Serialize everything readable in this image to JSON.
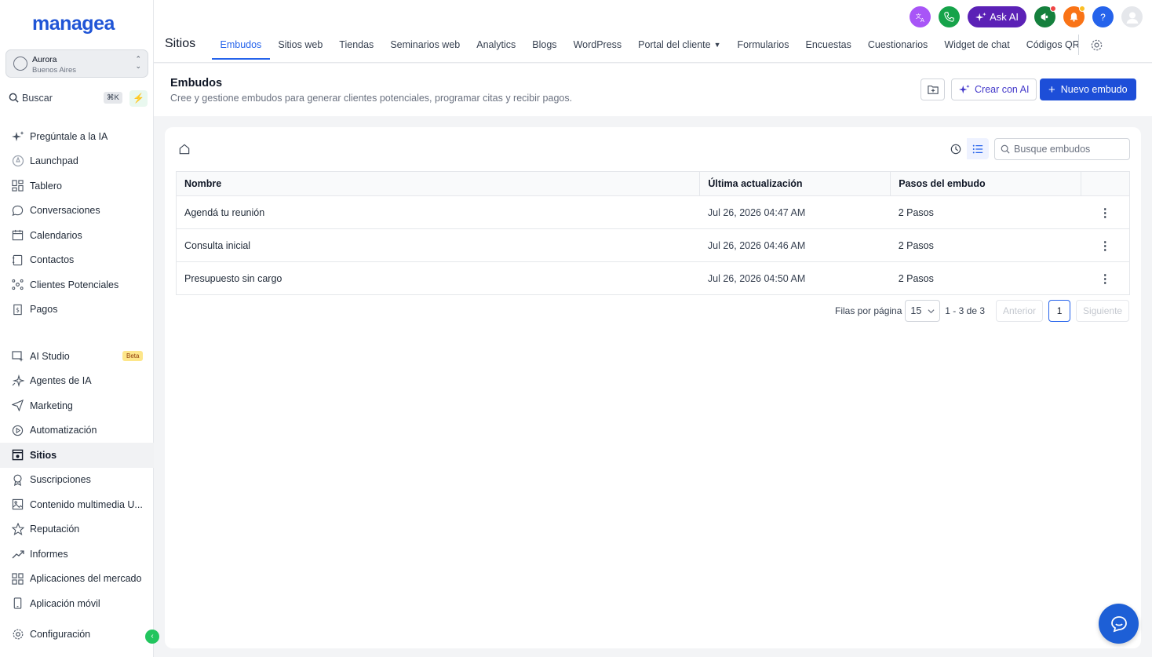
{
  "app": {
    "logo": "managea"
  },
  "account": {
    "name": "Aurora",
    "location": "Buenos Aires"
  },
  "search": {
    "label": "Buscar",
    "shortcut": "⌘K"
  },
  "sidebar": {
    "items": [
      {
        "label": "Pregúntale a la IA",
        "icon": "sparkles-icon"
      },
      {
        "label": "Launchpad",
        "icon": "rocket-icon"
      },
      {
        "label": "Tablero",
        "icon": "dashboard-icon"
      },
      {
        "label": "Conversaciones",
        "icon": "chat-bubble-icon"
      },
      {
        "label": "Calendarios",
        "icon": "calendar-icon"
      },
      {
        "label": "Contactos",
        "icon": "contacts-icon"
      },
      {
        "label": "Clientes Potenciales",
        "icon": "network-icon"
      },
      {
        "label": "Pagos",
        "icon": "invoice-icon"
      }
    ],
    "items2": [
      {
        "label": "AI Studio",
        "icon": "ai-studio-icon",
        "badge": "Beta"
      },
      {
        "label": "Agentes de IA",
        "icon": "ai-agent-icon"
      },
      {
        "label": "Marketing",
        "icon": "send-icon"
      },
      {
        "label": "Automatización",
        "icon": "automation-icon"
      },
      {
        "label": "Sitios",
        "icon": "sites-icon",
        "active": true
      },
      {
        "label": "Suscripciones",
        "icon": "badge-icon"
      },
      {
        "label": "Contenido multimedia U...",
        "icon": "image-icon"
      },
      {
        "label": "Reputación",
        "icon": "star-icon"
      },
      {
        "label": "Informes",
        "icon": "trend-icon"
      },
      {
        "label": "Aplicaciones del mercado",
        "icon": "apps-grid-icon"
      },
      {
        "label": "Aplicación móvil",
        "icon": "mobile-icon"
      }
    ],
    "settings": {
      "label": "Configuración",
      "icon": "gear-icon"
    }
  },
  "header": {
    "section": "Sitios",
    "ask_ai": "Ask AI",
    "tabs": [
      {
        "label": "Embudos",
        "active": true
      },
      {
        "label": "Sitios web"
      },
      {
        "label": "Tiendas"
      },
      {
        "label": "Seminarios web"
      },
      {
        "label": "Analytics"
      },
      {
        "label": "Blogs"
      },
      {
        "label": "WordPress"
      },
      {
        "label": "Portal del cliente",
        "dropdown": true
      },
      {
        "label": "Formularios"
      },
      {
        "label": "Encuestas"
      },
      {
        "label": "Cuestionarios"
      },
      {
        "label": "Widget de chat"
      },
      {
        "label": "Códigos QR"
      }
    ]
  },
  "page": {
    "title": "Embudos",
    "subtitle": "Cree y gestione embudos para generar clientes potenciales, programar citas y recibir pagos.",
    "create_ai_label": "Crear con AI",
    "new_label": "Nuevo embudo"
  },
  "funnels": {
    "search_placeholder": "Busque embudos",
    "columns": [
      "Nombre",
      "Última actualización",
      "Pasos del embudo",
      ""
    ],
    "rows": [
      {
        "name": "Agendá tu reunión",
        "updated": "Jul 26, 2026 04:47 AM",
        "steps": "2 Pasos"
      },
      {
        "name": "Consulta inicial",
        "updated": "Jul 26, 2026 04:46 AM",
        "steps": "2 Pasos"
      },
      {
        "name": "Presupuesto sin cargo",
        "updated": "Jul 26, 2026 04:50 AM",
        "steps": "2 Pasos"
      }
    ],
    "pagination": {
      "rows_label": "Filas por página",
      "per_page": "15",
      "range": "1 - 3 de 3",
      "prev": "Anterior",
      "page": "1",
      "next": "Siguiente"
    }
  },
  "colors": {
    "brand": "#2055d6",
    "accent": "#2563eb",
    "ask_ai": "#5b21b6",
    "success": "#22c55e"
  }
}
